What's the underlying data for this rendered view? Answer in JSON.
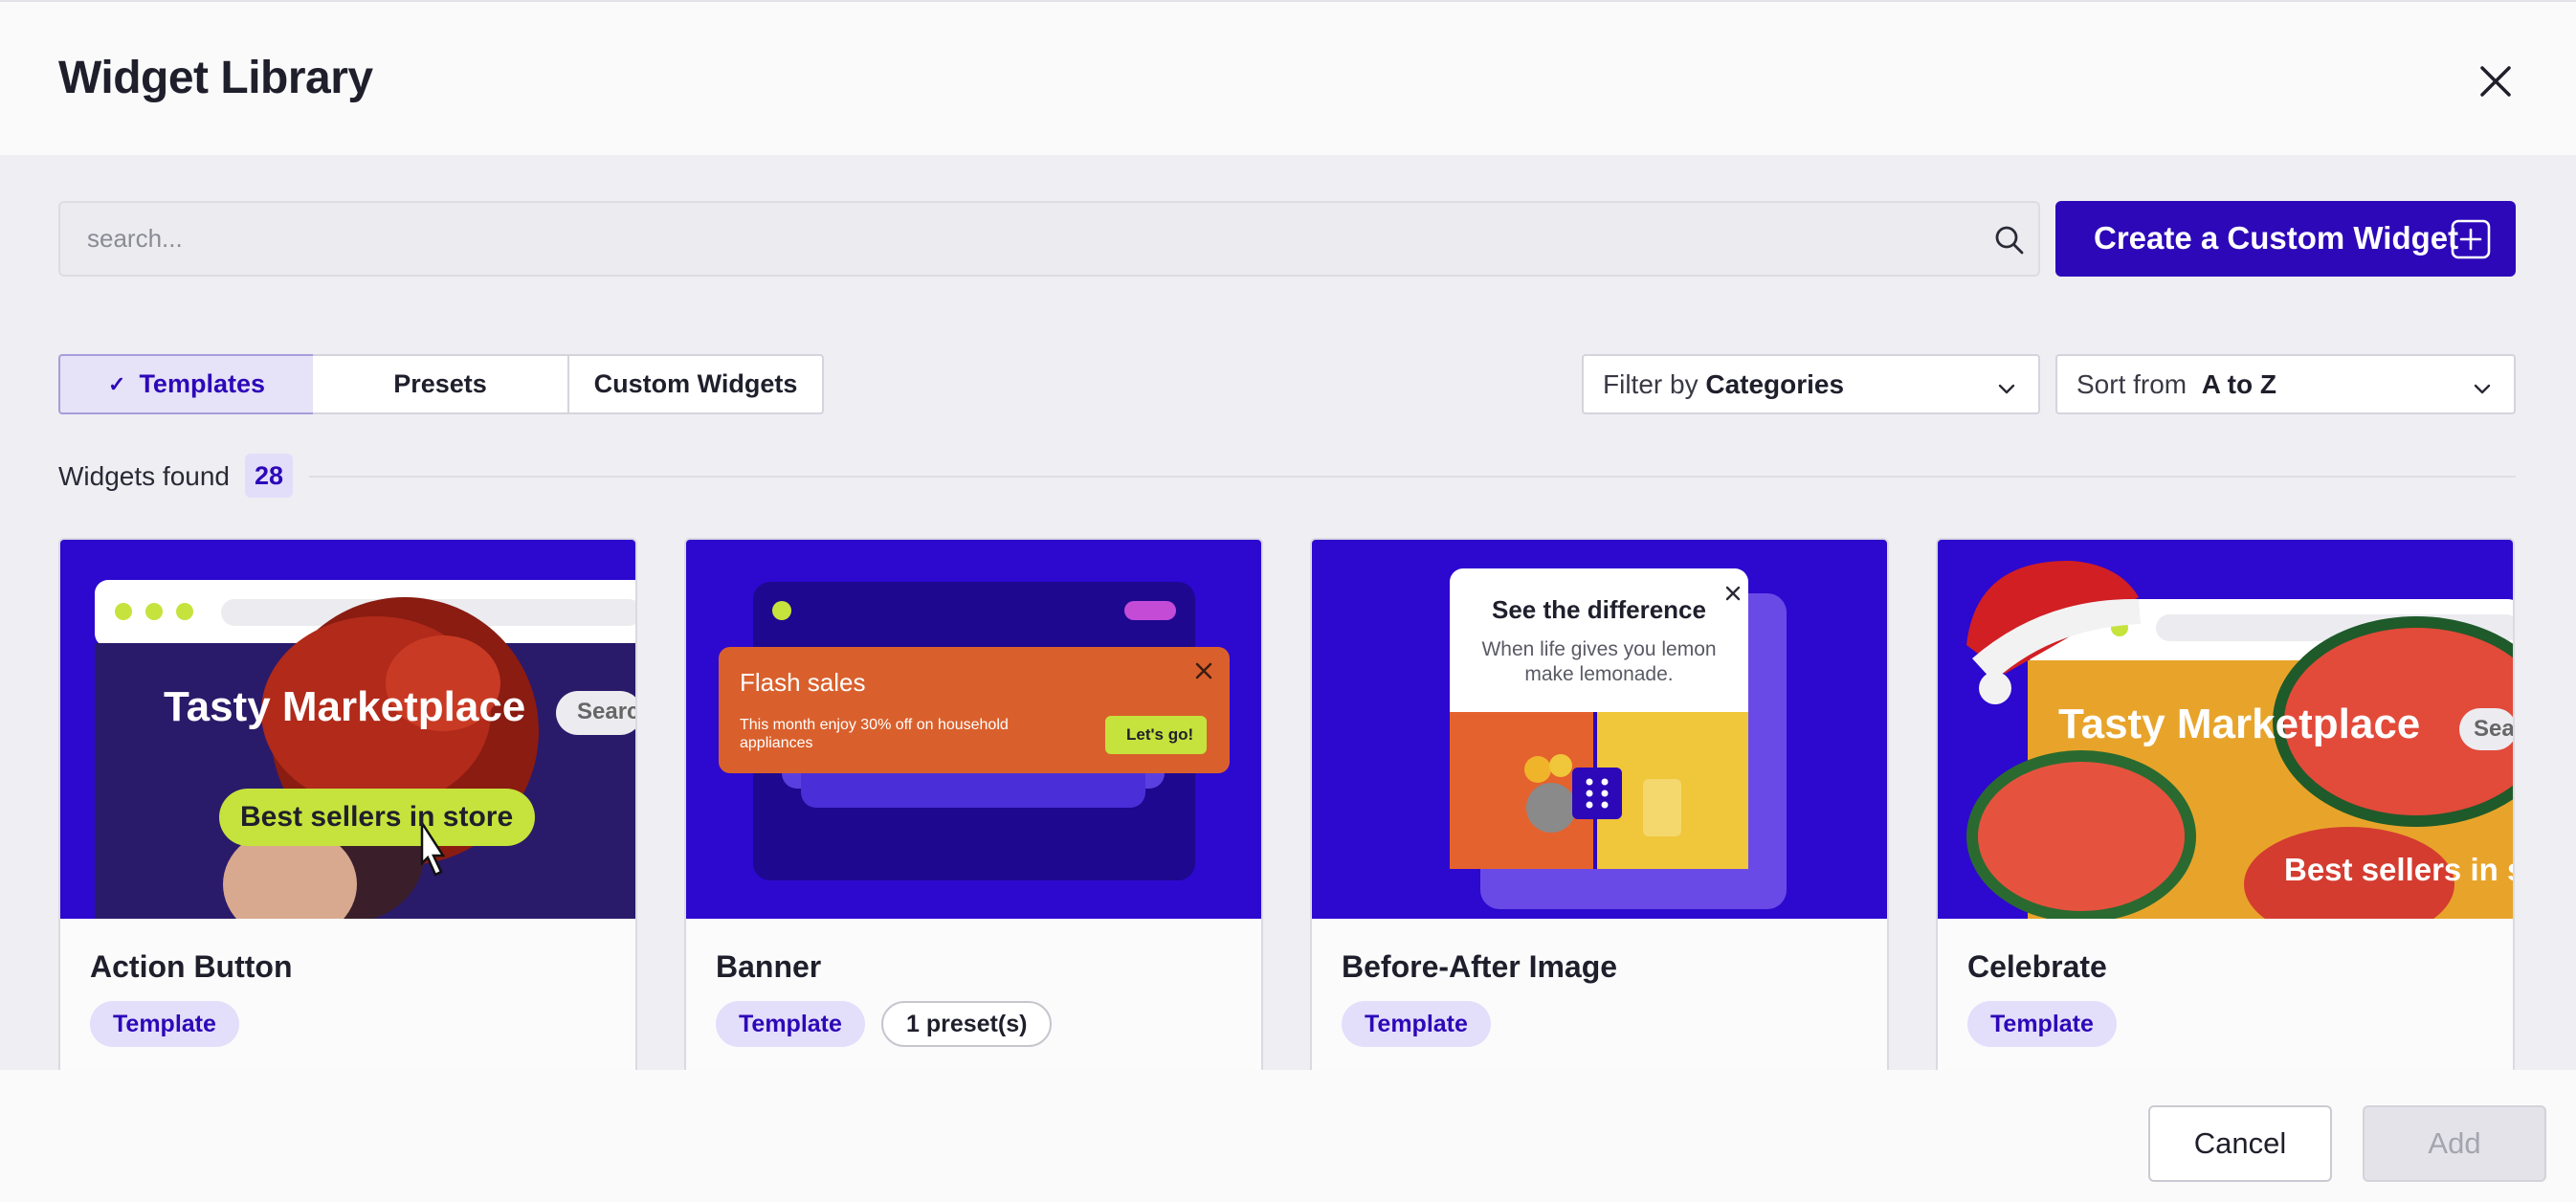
{
  "header": {
    "title": "Widget Library"
  },
  "search": {
    "placeholder": "search..."
  },
  "create_button": {
    "label": "Create a Custom Widget"
  },
  "tabs": [
    {
      "label": "Templates",
      "active": true
    },
    {
      "label": "Presets",
      "active": false
    },
    {
      "label": "Custom Widgets",
      "active": false
    }
  ],
  "filter": {
    "prefix": "Filter by",
    "value": "Categories"
  },
  "sort": {
    "prefix": "Sort from",
    "value": "A to Z"
  },
  "results": {
    "label": "Widgets found",
    "count": "28"
  },
  "cards": [
    {
      "name": "Action Button",
      "tags": [
        "Template"
      ],
      "preview": {
        "title": "Tasty Marketplace",
        "search": "Search",
        "cta": "Best sellers in store"
      }
    },
    {
      "name": "Banner",
      "tags": [
        "Template",
        "1 preset(s)"
      ],
      "preview": {
        "heading": "Flash sales",
        "body": "This month enjoy 30% off on household appliances",
        "cta": "Let's go!"
      }
    },
    {
      "name": "Before-After Image",
      "tags": [
        "Template"
      ],
      "preview": {
        "heading": "See the difference",
        "body": "When life gives you lemon make lemonade."
      }
    },
    {
      "name": "Celebrate",
      "tags": [
        "Template"
      ],
      "preview": {
        "title": "Tasty Marketplace",
        "search": "Sear",
        "cta": "Best sellers in s"
      }
    }
  ],
  "footer": {
    "cancel": "Cancel",
    "add": "Add"
  },
  "colors": {
    "brand": "#2d08b8",
    "accent_green": "#c5e33c",
    "banner_orange": "#d9602c"
  }
}
